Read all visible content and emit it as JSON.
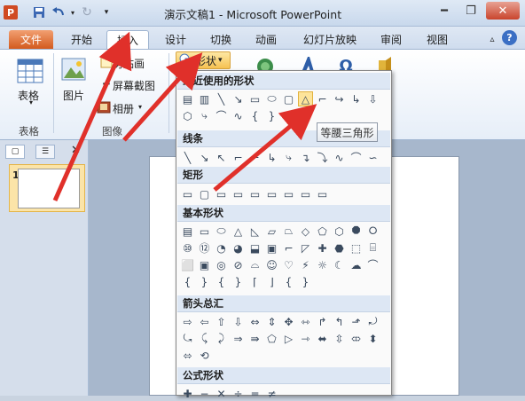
{
  "window": {
    "title": "演示文稿1 - Microsoft PowerPoint"
  },
  "tabs": [
    "文件",
    "开始",
    "插入",
    "设计",
    "切换",
    "动画",
    "幻灯片放映",
    "审阅",
    "视图"
  ],
  "ribbon": {
    "table_label": "表格",
    "table_group": "表格",
    "picture_label": "图片",
    "clipart_label": "剪贴画",
    "screenshot_label": "屏幕截图",
    "album_label": "相册",
    "image_group": "图像",
    "shapes_label": "形状"
  },
  "dropdown": {
    "sections": [
      "最近使用的形状",
      "线条",
      "矩形",
      "基本形状",
      "箭头总汇",
      "公式形状"
    ]
  },
  "tooltip": "等腰三角形",
  "thumbnail": {
    "number": "1"
  },
  "colors": {
    "accent_red": "#e0302a",
    "file_tab": "#d35a1e",
    "highlight": "#fde49a"
  }
}
